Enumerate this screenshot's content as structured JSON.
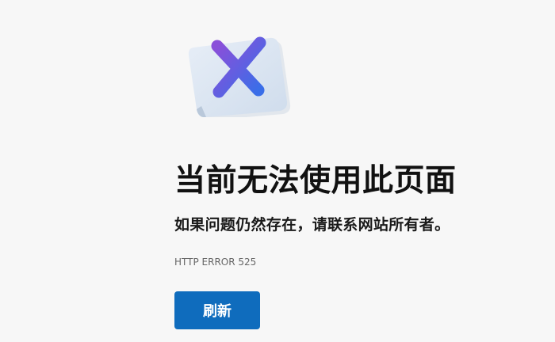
{
  "illustration": {
    "icon": "error-x-page-icon",
    "x_gradient": [
      "#7b4ed8",
      "#3b6fe8"
    ],
    "page_color": "#dbe6f3"
  },
  "main": {
    "title": "当前无法使用此页面",
    "subtitle": "如果问题仍然存在，请联系网站所有者。",
    "error_code": "HTTP ERROR 525",
    "refresh_label": "刷新"
  },
  "colors": {
    "background": "#f7f7f7",
    "button": "#0f6cbd",
    "title": "#111111"
  }
}
